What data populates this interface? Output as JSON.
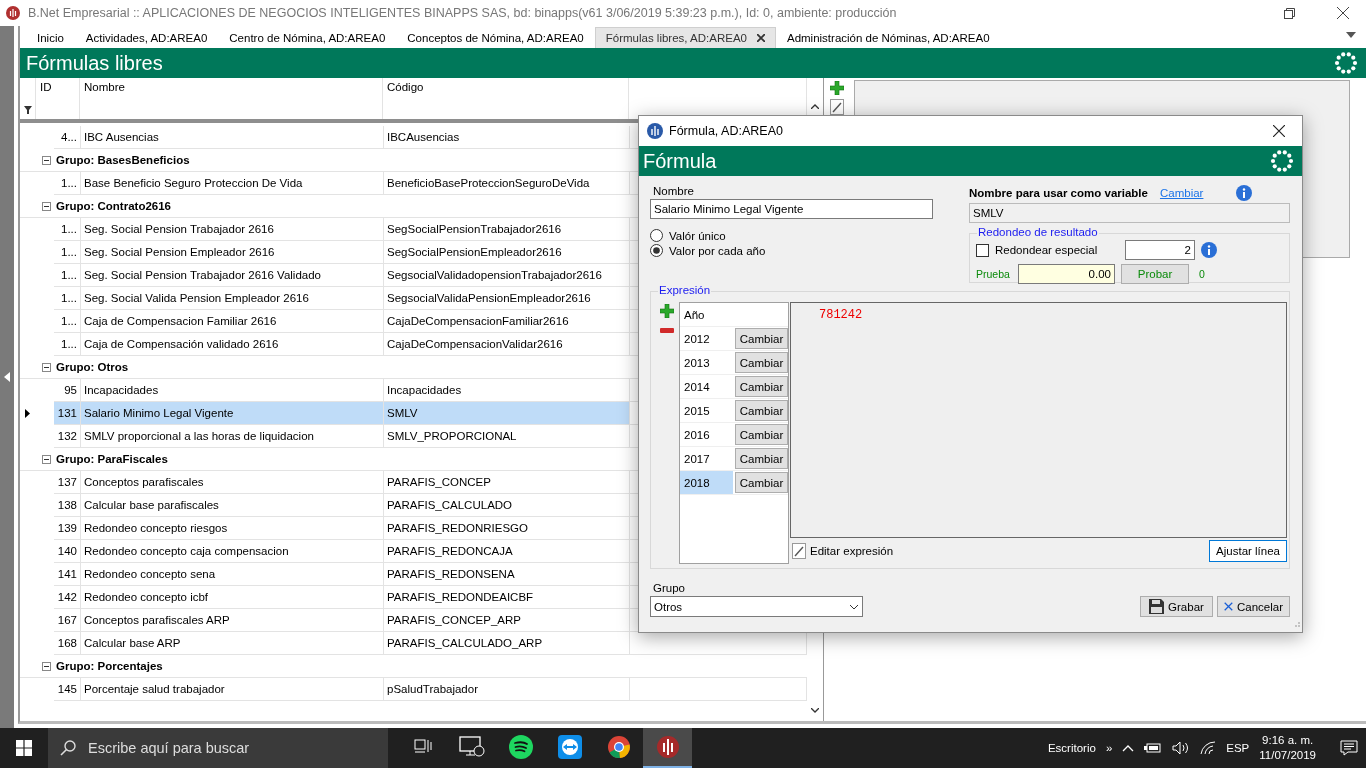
{
  "window": {
    "title": "B.Net Empresarial  ::  APLICACIONES DE NEGOCIOS INTELIGENTES BINAPPS SAS, bd: binapps(v61 3/06/2019 5:39:23 p.m.), Id: 0, ambiente: producción"
  },
  "tabs": [
    {
      "label": "Inicio",
      "selected": false
    },
    {
      "label": "Actividades, AD:AREA0",
      "selected": false
    },
    {
      "label": "Centro de Nómina, AD:AREA0",
      "selected": false
    },
    {
      "label": "Conceptos de Nómina, AD:AREA0",
      "selected": false
    },
    {
      "label": "Fórmulas libres, AD:AREA0",
      "selected": true
    },
    {
      "label": "Administración de Nóminas, AD:AREA0",
      "selected": false
    }
  ],
  "page_title": "Fórmulas libres",
  "table": {
    "columns": [
      "ID",
      "Nombre",
      "Código"
    ],
    "groups": [
      {
        "rows": [
          {
            "id": "4...",
            "nombre": "IBC Ausencias",
            "codigo": "IBCAusencias",
            "selected": false
          }
        ]
      },
      {
        "label": "Grupo: BasesBeneficios",
        "expanded": true,
        "rows": [
          {
            "id": "1...",
            "nombre": "Base Beneficio Seguro Proteccion De Vida",
            "codigo": "BeneficioBaseProteccionSeguroDeVida",
            "selected": false
          }
        ]
      },
      {
        "label": "Grupo: Contrato2616",
        "expanded": true,
        "rows": [
          {
            "id": "1...",
            "nombre": "Seg. Social Pension Trabajador 2616",
            "codigo": "SegSocialPensionTrabajador2616",
            "selected": false
          },
          {
            "id": "1...",
            "nombre": "Seg. Social Pension Empleador 2616",
            "codigo": "SegSocialPensionEmpleador2616",
            "selected": false
          },
          {
            "id": "1...",
            "nombre": "Seg. Social Pension Trabajador 2616 Validado",
            "codigo": "SegsocialValidadopensionTrabajador2616",
            "selected": false
          },
          {
            "id": "1...",
            "nombre": "Seg. Social Valida Pension Empleador 2616",
            "codigo": "SegsocialValidaPensionEmpleador2616",
            "selected": false
          },
          {
            "id": "1...",
            "nombre": "Caja de Compensacion Familiar 2616",
            "codigo": "CajaDeCompensacionFamiliar2616",
            "selected": false
          },
          {
            "id": "1...",
            "nombre": "Caja de Compensación validado 2616",
            "codigo": "CajaDeCompensacionValidar2616",
            "selected": false
          }
        ]
      },
      {
        "label": "Grupo: Otros",
        "expanded": true,
        "rows": [
          {
            "id": "95",
            "nombre": "Incapacidades",
            "codigo": "Incapacidades",
            "selected": false
          },
          {
            "id": "131",
            "nombre": "Salario Minimo Legal Vigente",
            "codigo": "SMLV",
            "selected": true
          },
          {
            "id": "132",
            "nombre": "SMLV proporcional a las horas de liquidacion",
            "codigo": "SMLV_PROPORCIONAL",
            "selected": false
          }
        ]
      },
      {
        "label": "Grupo: ParaFiscales",
        "expanded": true,
        "rows": [
          {
            "id": "137",
            "nombre": "Conceptos parafiscales",
            "codigo": "PARAFIS_CONCEP",
            "selected": false
          },
          {
            "id": "138",
            "nombre": "Calcular base parafiscales",
            "codigo": "PARAFIS_CALCULADO",
            "selected": false
          },
          {
            "id": "139",
            "nombre": "Redondeo concepto riesgos",
            "codigo": "PARAFIS_REDONRIESGO",
            "selected": false
          },
          {
            "id": "140",
            "nombre": "Redondeo concepto caja compensacion",
            "codigo": "PARAFIS_REDONCAJA",
            "selected": false
          },
          {
            "id": "141",
            "nombre": "Redondeo concepto sena",
            "codigo": "PARAFIS_REDONSENA",
            "selected": false
          },
          {
            "id": "142",
            "nombre": "Redondeo concepto icbf",
            "codigo": "PARAFIS_REDONDEAICBF",
            "selected": false
          },
          {
            "id": "167",
            "nombre": "Conceptos parafiscales ARP",
            "codigo": "PARAFIS_CONCEP_ARP",
            "selected": false
          },
          {
            "id": "168",
            "nombre": "Calcular base ARP",
            "codigo": "PARAFIS_CALCULADO_ARP",
            "selected": false
          }
        ]
      },
      {
        "label": "Grupo: Porcentajes",
        "expanded": true,
        "rows": [
          {
            "id": "145",
            "nombre": "Porcentaje salud trabajador",
            "codigo": "pSaludTrabajador",
            "selected": false
          }
        ]
      }
    ]
  },
  "dialog": {
    "title": "Fórmula, AD:AREA0",
    "header": "Fórmula",
    "name_label": "Nombre",
    "name_value": "Salario Minimo Legal Vigente",
    "variable_label": "Nombre para usar como variable",
    "variable_link": "Cambiar",
    "variable_value": "SMLV",
    "modes": [
      {
        "label": "Valór único",
        "selected": false
      },
      {
        "label": "Valor por cada año",
        "selected": true
      }
    ],
    "rounding": {
      "legend": "Redondeo de resultado",
      "checkbox_label": "Redondear especial",
      "checked": false,
      "decimals": "2",
      "test_label": "Prueba",
      "test_value": "0.00",
      "test_button": "Probar",
      "test_result": "0"
    },
    "expression": {
      "legend": "Expresión",
      "year_header": "Año",
      "years": [
        {
          "year": "2012",
          "button": "Cambiar",
          "selected": false
        },
        {
          "year": "2013",
          "button": "Cambiar",
          "selected": false
        },
        {
          "year": "2014",
          "button": "Cambiar",
          "selected": false
        },
        {
          "year": "2015",
          "button": "Cambiar",
          "selected": false
        },
        {
          "year": "2016",
          "button": "Cambiar",
          "selected": false
        },
        {
          "year": "2017",
          "button": "Cambiar",
          "selected": false
        },
        {
          "year": "2018",
          "button": "Cambiar",
          "selected": true
        }
      ],
      "text": "781242",
      "edit_label": "Editar expresión",
      "wrap_button": "Ajustar línea"
    },
    "group_label": "Grupo",
    "group_value": "Otros",
    "buttons": [
      "Grabar",
      "Cancelar"
    ]
  },
  "taskbar": {
    "search_placeholder": "Escribe aquí para buscar",
    "apps": [
      {
        "kind": "taskview",
        "active": false
      },
      {
        "kind": "monitor",
        "active": false
      },
      {
        "kind": "music",
        "active": false
      },
      {
        "kind": "remote",
        "active": false
      },
      {
        "kind": "browser",
        "active": false
      },
      {
        "kind": "logo",
        "active": true
      }
    ],
    "tray_label": "Escritorio",
    "tray_more": "»",
    "language": "ESP",
    "time": "9:16 a. m.",
    "date": "11/07/2019"
  }
}
